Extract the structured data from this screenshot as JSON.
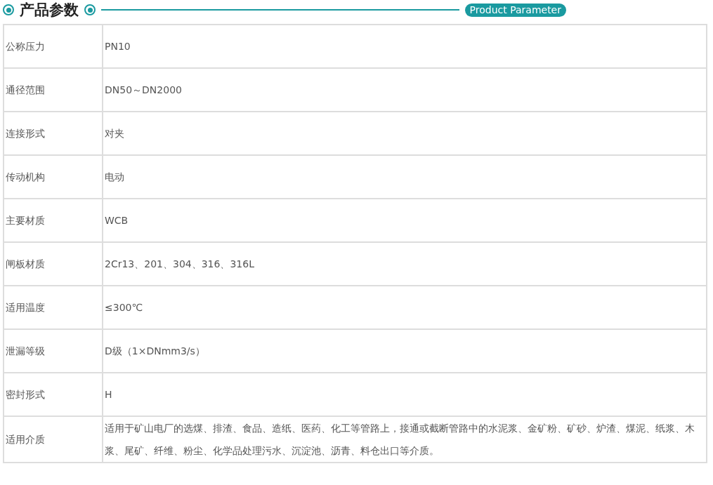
{
  "header": {
    "title": "产品参数",
    "subtitle": "Product Parameter"
  },
  "table": {
    "rows": [
      {
        "label": "公称压力",
        "value": "PN10"
      },
      {
        "label": "通径范围",
        "value": "DN50～DN2000"
      },
      {
        "label": "连接形式",
        "value": "对夹"
      },
      {
        "label": "传动机构",
        "value": "电动"
      },
      {
        "label": "主要材质",
        "value": "WCB"
      },
      {
        "label": "闸板材质",
        "value": "2Cr13、201、304、316、316L"
      },
      {
        "label": "适用温度",
        "value": "≤300℃"
      },
      {
        "label": "泄漏等级",
        "value": "D级（1×DNmm3/s）"
      },
      {
        "label": "密封形式",
        "value": "H"
      },
      {
        "label": "适用介质",
        "value": "适用于矿山电厂的选煤、排渣、食品、造纸、医药、化工等管路上，接通或截断管路中的水泥浆、金矿粉、矿砂、炉渣、煤泥、纸浆、木浆、尾矿、纤维、粉尘、化学品处理污水、沉淀池、沥青、料仓出口等介质。"
      }
    ]
  }
}
